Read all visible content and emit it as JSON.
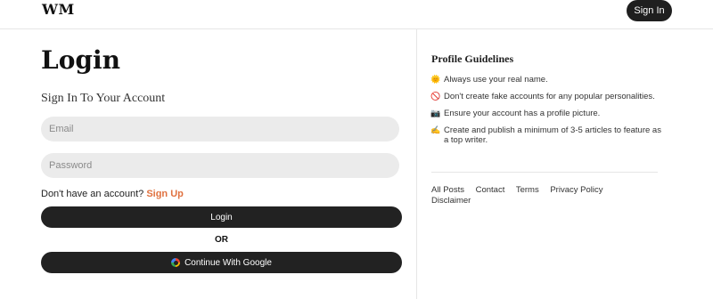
{
  "header": {
    "logo": "WM",
    "signin_label": "Sign In"
  },
  "login": {
    "title": "Login",
    "subtitle": "Sign In To Your Account",
    "email_placeholder": "Email",
    "password_placeholder": "Password",
    "no_account_text": "Don't have an account?",
    "signup_label": "Sign Up",
    "login_button": "Login",
    "or_text": "OR",
    "google_button": "Continue With Google"
  },
  "guidelines": {
    "title": "Profile Guidelines",
    "items": [
      {
        "icon": "🌞",
        "text": "Always use your real name."
      },
      {
        "icon": "🚫",
        "text": "Don't create fake accounts for any popular personalities."
      },
      {
        "icon": "📷",
        "text": "Ensure your account has a profile picture."
      },
      {
        "icon": "✍️",
        "text": "Create and publish a minimum of 3-5 articles to feature as a top writer."
      }
    ]
  },
  "footer": {
    "links": [
      "All Posts",
      "Contact",
      "Terms",
      "Privacy Policy",
      "Disclaimer"
    ]
  },
  "colors": {
    "accent": "#e0713f",
    "dark_button": "#222222",
    "input_bg": "#ebebeb"
  }
}
